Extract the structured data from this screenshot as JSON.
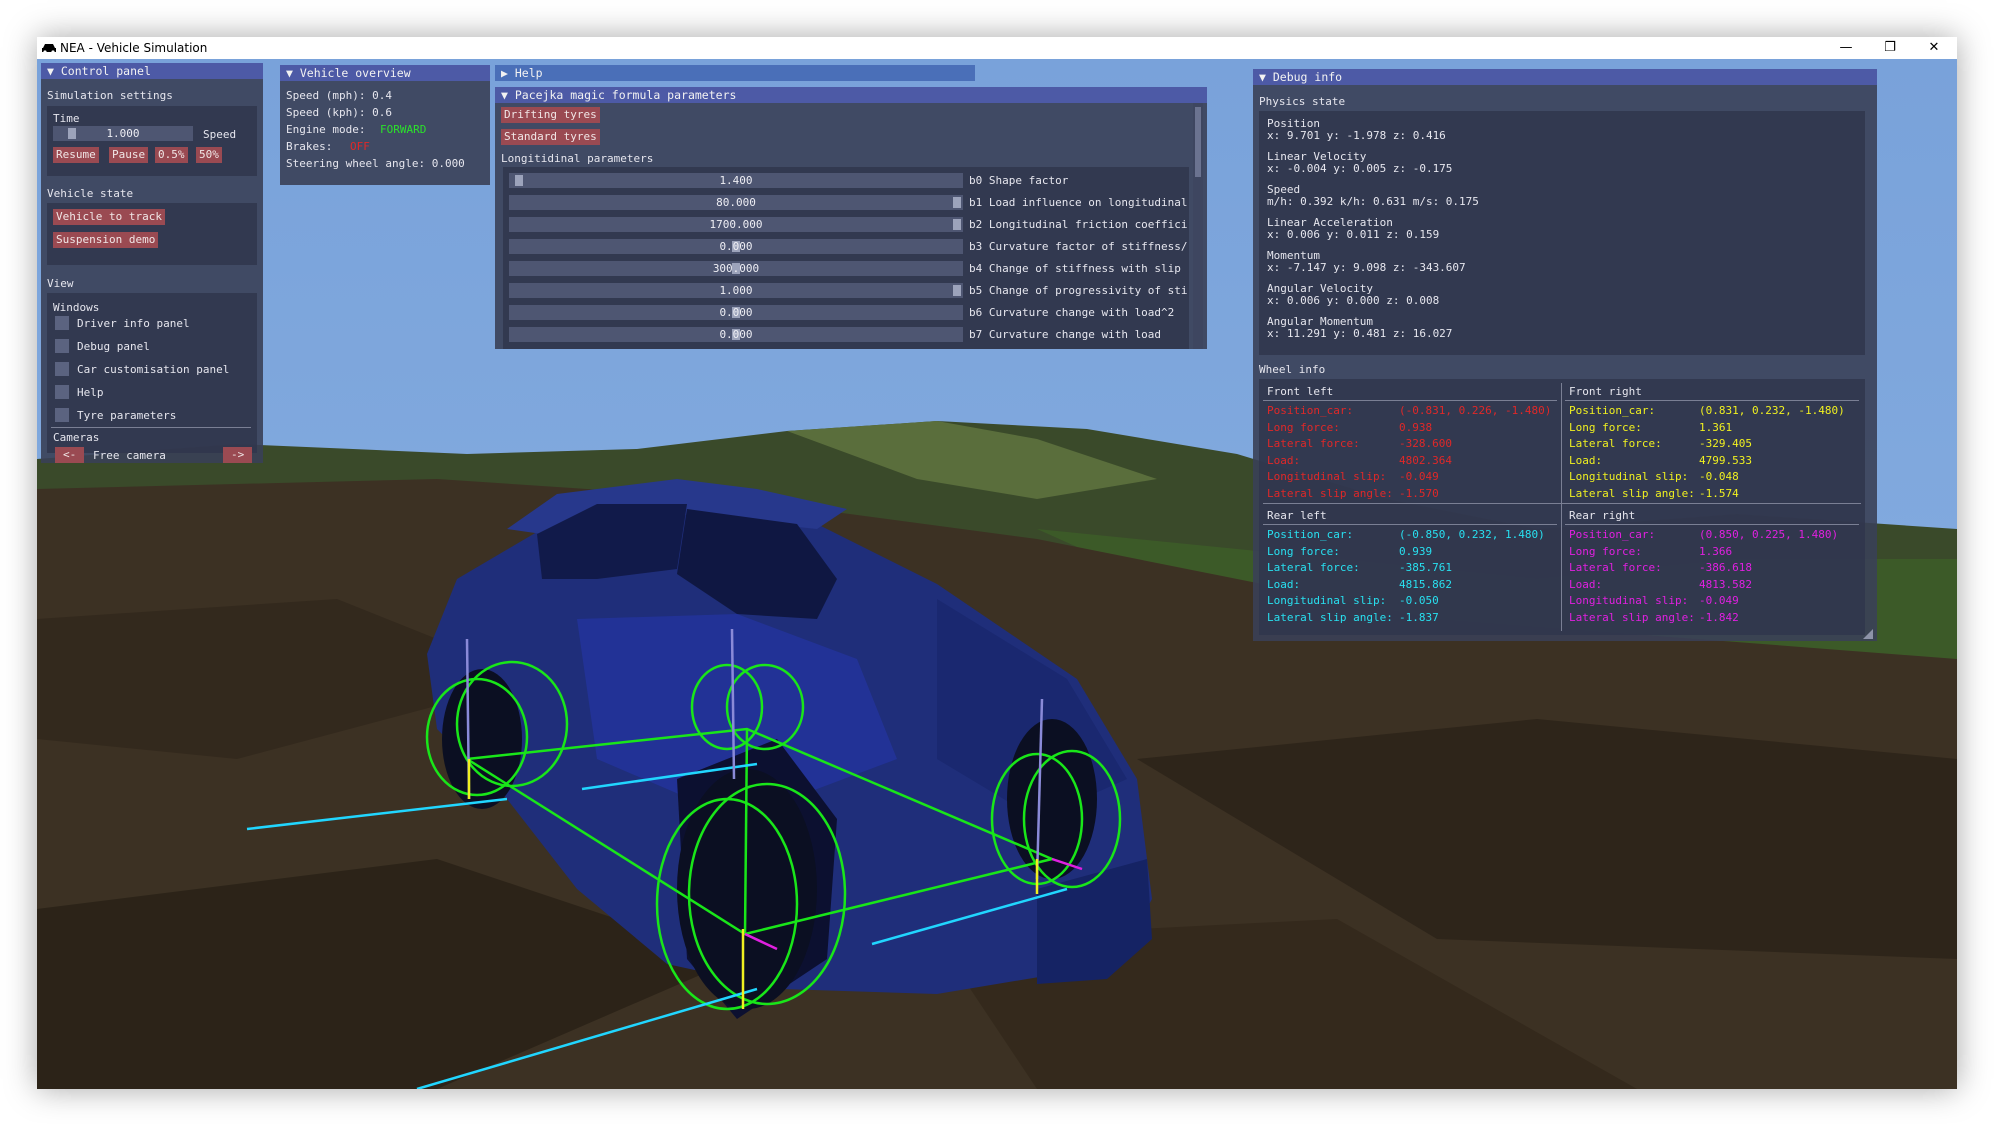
{
  "window": {
    "title": "NEA - Vehicle Simulation",
    "minimize_glyph": "—",
    "restore_glyph": "❐",
    "close_glyph": "✕"
  },
  "control_panel": {
    "title": "Control panel",
    "simulation_settings": "Simulation settings",
    "time_label": "Time",
    "speed_value": "1.000",
    "speed_label": "Speed",
    "speed_fraction": 0.1,
    "buttons": [
      "Resume",
      "Pause",
      "0.5%",
      "50%"
    ],
    "vehicle_state": "Vehicle state",
    "vehicle_buttons": [
      "Vehicle to track",
      "Suspension demo"
    ],
    "view": "View",
    "windows_label": "Windows",
    "windows": [
      "Driver info panel",
      "Debug panel",
      "Car customisation panel",
      "Help",
      "Tyre parameters"
    ],
    "cameras_label": "Cameras",
    "camera_prev": "<-",
    "camera_name": "Free camera",
    "camera_next": "->"
  },
  "vehicle_overview": {
    "title": "Vehicle overview",
    "speed_mph": "Speed (mph): 0.4",
    "speed_kph": "Speed (kph): 0.6",
    "engine_label": "Engine mode:",
    "engine_value": "FORWARD",
    "brakes_label": "Brakes:",
    "brakes_value": "OFF",
    "steering": "Steering wheel angle: 0.000"
  },
  "help": {
    "title": "Help"
  },
  "pacejka": {
    "title": "Pacejka magic formula parameters",
    "buttons": [
      "Drifting tyres",
      "Standard tyres"
    ],
    "section": "Longitidinal parameters",
    "params": [
      {
        "value": "1.400",
        "label": "b0 Shape factor",
        "fraction": 0.01
      },
      {
        "value": "80.000",
        "label": "b1 Load influence on longitudinal",
        "fraction": 1.0
      },
      {
        "value": "1700.000",
        "label": "b2 Longitudinal friction coeffici",
        "fraction": 1.0
      },
      {
        "value": "0.000",
        "label": "b3 Curvature factor of stiffness/",
        "fraction": 0.5
      },
      {
        "value": "300.000",
        "label": "b4 Change of stiffness with slip",
        "fraction": 0.5
      },
      {
        "value": "1.000",
        "label": "b5 Change of progressivity of sti",
        "fraction": 1.0
      },
      {
        "value": "0.000",
        "label": "b6 Curvature change with load^2",
        "fraction": 0.5
      },
      {
        "value": "0.000",
        "label": "b7 Curvature change with load",
        "fraction": 0.5
      }
    ]
  },
  "debug": {
    "title": "Debug info",
    "physics_state": "Physics state",
    "items": [
      {
        "label": "Position",
        "value": "x: 9.701 y: -1.978 z: 0.416"
      },
      {
        "label": "Linear Velocity",
        "value": "x: -0.004 y: 0.005 z: -0.175"
      },
      {
        "label": "Speed",
        "value": "m/h: 0.392 k/h: 0.631 m/s: 0.175"
      },
      {
        "label": "Linear Acceleration",
        "value": "x: 0.006 y: 0.011 z: 0.159"
      },
      {
        "label": "Momentum",
        "value": "x: -7.147 y: 9.098 z: -343.607"
      },
      {
        "label": "Angular Velocity",
        "value": "x: 0.006 y: 0.000 z: 0.008"
      },
      {
        "label": "Angular Momentum",
        "value": "x: 11.291 y: 0.481 z: 16.027"
      }
    ],
    "wheel_info": "Wheel info",
    "wheels": [
      {
        "name": "Front left",
        "color": "#e02828",
        "rows": [
          [
            "Position_car:",
            "(-0.831, 0.226, -1.480)"
          ],
          [
            "Long force:",
            "0.938"
          ],
          [
            "Lateral force:",
            "-328.600"
          ],
          [
            "Load:",
            "4802.364"
          ],
          [
            "Longitudinal slip:",
            "-0.049"
          ],
          [
            "Lateral slip angle:",
            "-1.570"
          ]
        ]
      },
      {
        "name": "Front right",
        "color": "#f0f020",
        "rows": [
          [
            "Position_car:",
            "(0.831, 0.232, -1.480)"
          ],
          [
            "Long force:",
            "1.361"
          ],
          [
            "Lateral force:",
            "-329.405"
          ],
          [
            "Load:",
            "4799.533"
          ],
          [
            "Longitudinal slip:",
            "-0.048"
          ],
          [
            "Lateral slip angle:",
            "-1.574"
          ]
        ]
      },
      {
        "name": "Rear left",
        "color": "#28e0f0",
        "rows": [
          [
            "Position_car:",
            "(-0.850, 0.232, 1.480)"
          ],
          [
            "Long force:",
            "0.939"
          ],
          [
            "Lateral force:",
            "-385.761"
          ],
          [
            "Load:",
            "4815.862"
          ],
          [
            "Longitudinal slip:",
            "-0.050"
          ],
          [
            "Lateral slip angle:",
            "-1.837"
          ]
        ]
      },
      {
        "name": "Rear right",
        "color": "#e020e0",
        "rows": [
          [
            "Position_car:",
            "(0.850, 0.225, 1.480)"
          ],
          [
            "Long force:",
            "1.366"
          ],
          [
            "Lateral force:",
            "-386.618"
          ],
          [
            "Load:",
            "4813.582"
          ],
          [
            "Longitudinal slip:",
            "-0.049"
          ],
          [
            "Lateral slip angle:",
            "-1.842"
          ]
        ]
      }
    ]
  },
  "colors": {
    "sky": "#7ea7dc",
    "ground": "#3d3223",
    "car": "#1f2e7a",
    "wheel_outline": "#19e619",
    "force_line": "#21d6ff",
    "suspension": "#8a8ad8"
  }
}
